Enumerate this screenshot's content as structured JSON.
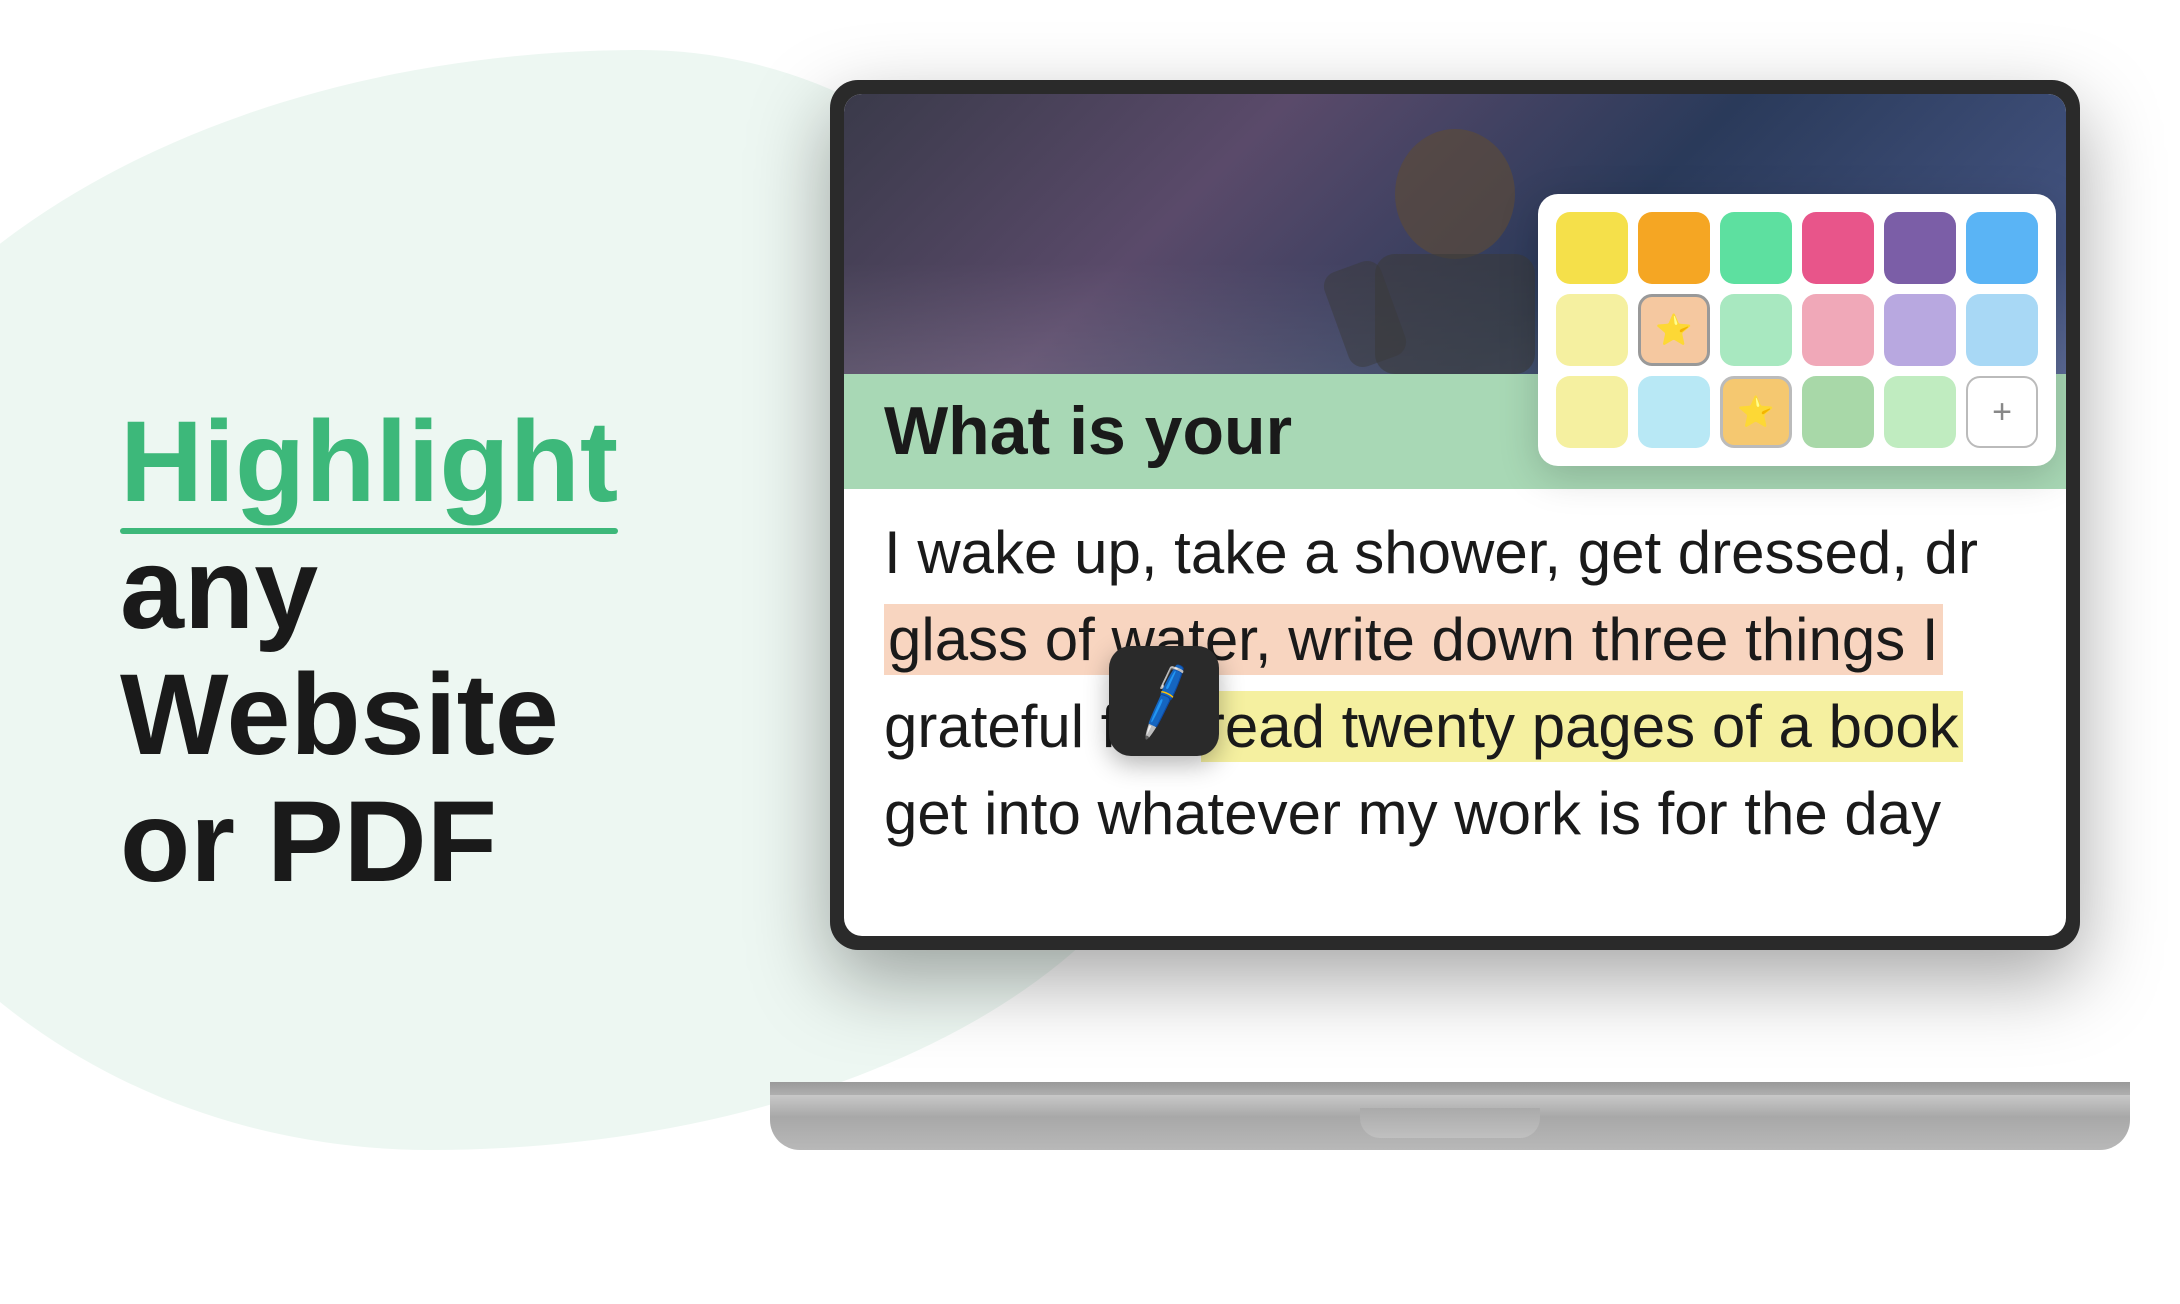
{
  "background": {
    "blob_color": "#edf7f2"
  },
  "left": {
    "line1": "Highlight",
    "line2": "any",
    "line3": "Website or PDF"
  },
  "screen": {
    "heading_text": "What is your",
    "heading_suffix": "?",
    "body_line1": "I wake up, take a shower, get dressed, dr",
    "body_line2": "glass of water, write down three things I",
    "body_line3_pre": "grateful for, ",
    "body_line3_highlight": "read twenty pages of a book",
    "body_line4": "get into whatever my work is for the day"
  },
  "color_picker": {
    "row1": [
      {
        "color": "#f5e04a",
        "label": "yellow"
      },
      {
        "color": "#f5a623",
        "label": "orange"
      },
      {
        "color": "#5de0a0",
        "label": "green"
      },
      {
        "color": "#e8558a",
        "label": "pink"
      },
      {
        "color": "#7b5ea7",
        "label": "purple"
      },
      {
        "color": "#5ab4f5",
        "label": "blue"
      }
    ],
    "row2": [
      {
        "color": "#f5f0a0",
        "label": "light-yellow",
        "selected": false
      },
      {
        "color": "#f5c8a0",
        "label": "light-orange",
        "selected": true,
        "starred": true
      },
      {
        "color": "#a8e8c0",
        "label": "light-green"
      },
      {
        "color": "#f0a8b8",
        "label": "light-pink"
      },
      {
        "color": "#b8a8e0",
        "label": "light-purple"
      },
      {
        "color": "#a8d8f5",
        "label": "light-blue"
      }
    ],
    "row3": [
      {
        "color": "#f5f0a0",
        "label": "pale-yellow"
      },
      {
        "color": "#b8e8f5",
        "label": "pale-blue"
      },
      {
        "color": "#f5c870",
        "label": "pale-orange",
        "starred": true
      },
      {
        "color": "#a8d8a8",
        "label": "pale-green"
      },
      {
        "color": "#c0ecc0",
        "label": "mint"
      },
      {
        "color": "add",
        "label": "add-custom"
      }
    ]
  },
  "eraser": {
    "icon": "✏️"
  }
}
